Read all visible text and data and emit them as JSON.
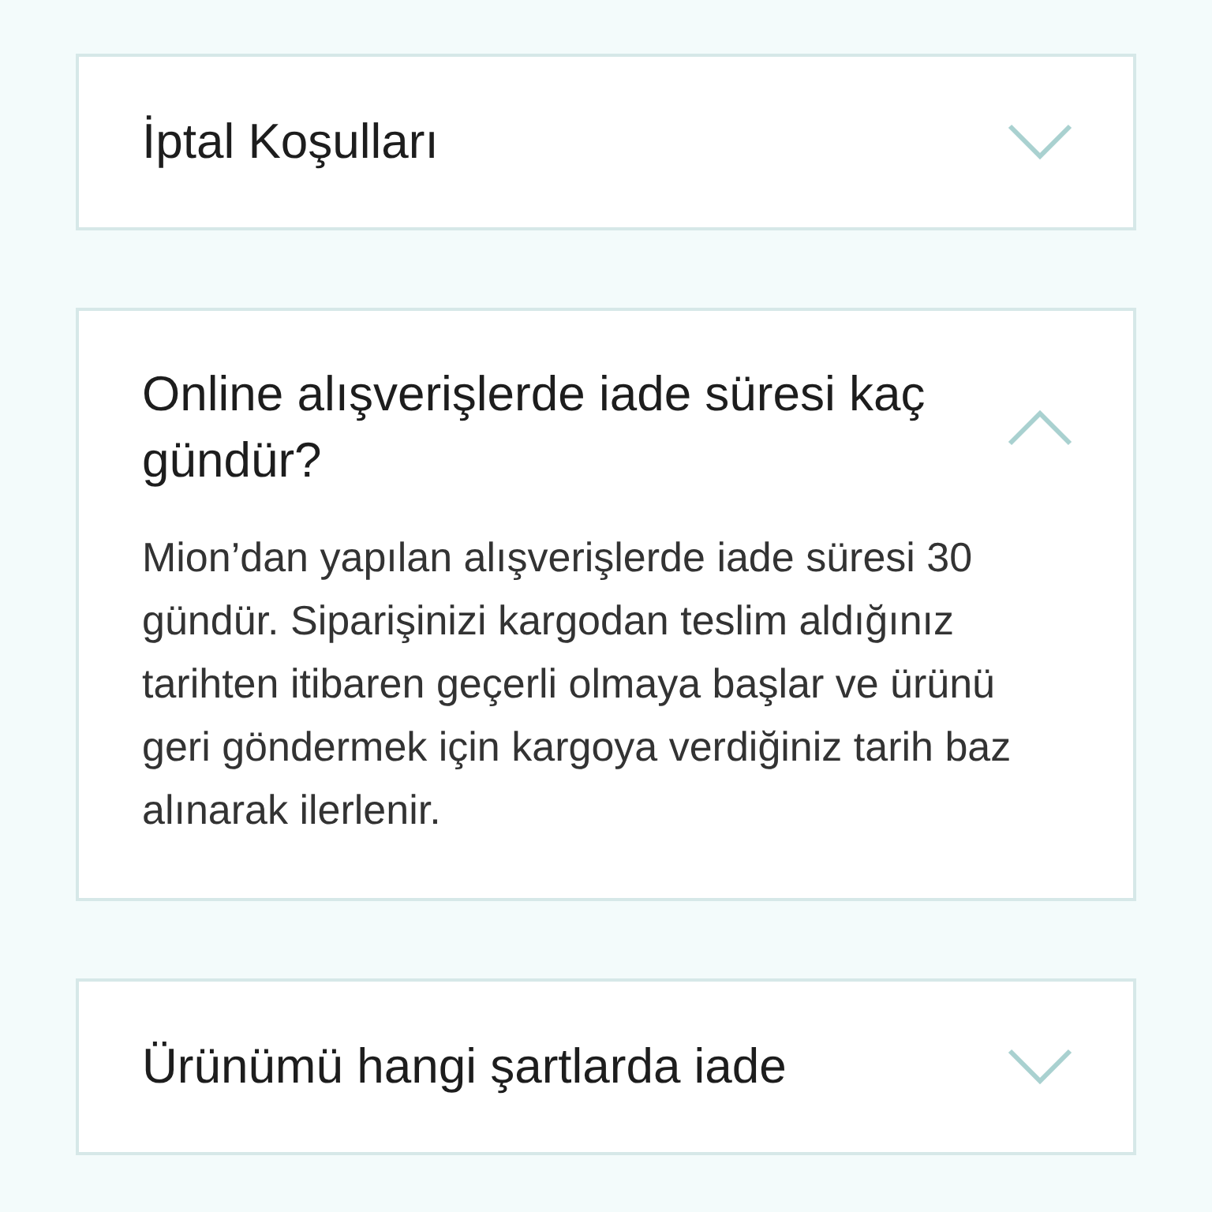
{
  "faq_items": [
    {
      "title": "İptal Koşulları",
      "expanded": false
    },
    {
      "title": "Online alışverişlerde iade süresi kaç gündür?",
      "expanded": true,
      "answer": "Mion’dan yapılan alışverişlerde iade süresi 30 gündür. Siparişinizi kargodan teslim aldığınız tarihten itibaren geçerli olmaya başlar ve ürünü geri göndermek için kargoya verdiğiniz tarih baz alınarak ilerlenir."
    },
    {
      "title": "Ürünümü hangi şartlarda iade",
      "expanded": false
    }
  ]
}
